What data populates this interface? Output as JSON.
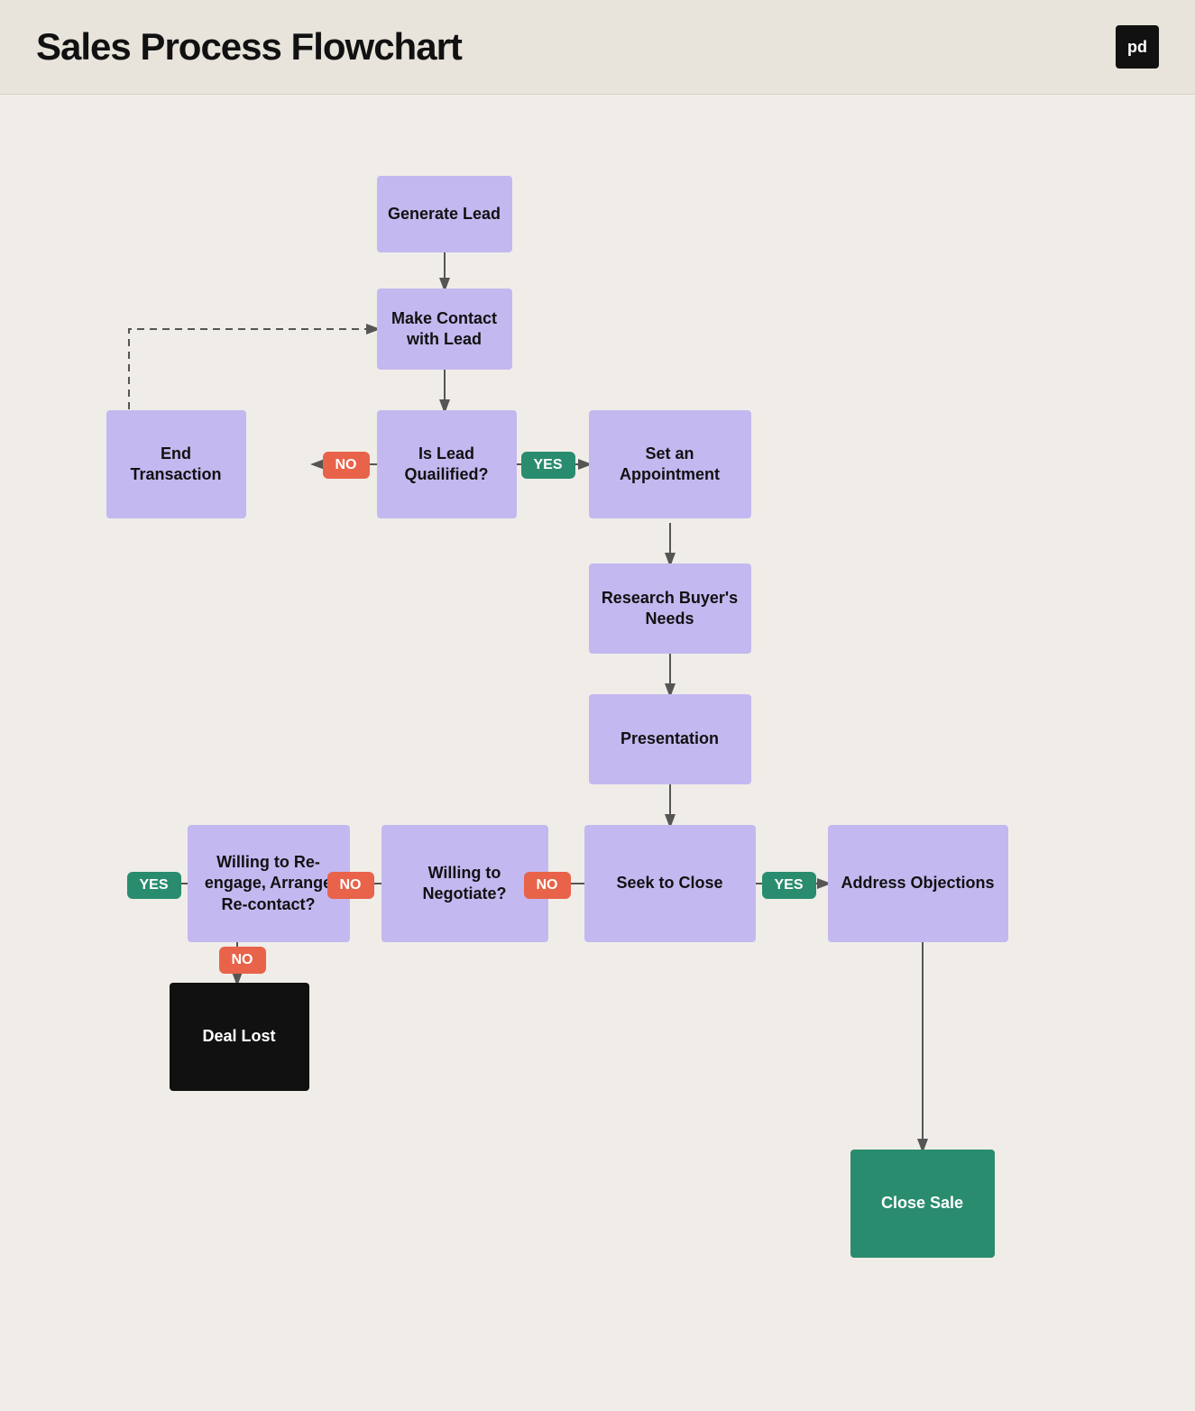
{
  "header": {
    "title": "Sales Process Flowchart",
    "logo": "pd"
  },
  "nodes": {
    "generate_lead": "Generate Lead",
    "make_contact": "Make Contact with Lead",
    "is_qualified": "Is Lead Quailified?",
    "end_transaction": "End Transaction",
    "set_appointment": "Set an Appointment",
    "research_needs": "Research Buyer's Needs",
    "presentation": "Presentation",
    "seek_close": "Seek to Close",
    "address_objections": "Address Objections",
    "willing_negotiate": "Willing to Negotiate?",
    "willing_reengage": "Willing to Re-engage, Arrange Re-contact?",
    "deal_lost": "Deal Lost",
    "close_sale": "Close Sale"
  },
  "badges": {
    "yes": "YES",
    "no": "NO"
  }
}
